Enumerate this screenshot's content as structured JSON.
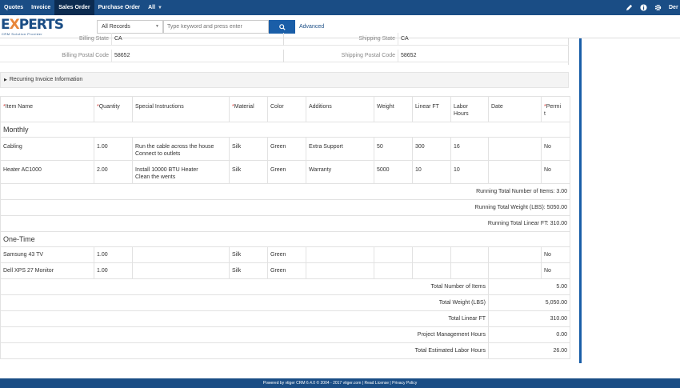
{
  "nav": {
    "tabs": [
      "Quotes",
      "Invoice",
      "Sales Order",
      "Purchase Order",
      "All"
    ],
    "active_tab": "Sales Order",
    "user": "Der"
  },
  "header": {
    "logo_main": "E",
    "logo_x": "X",
    "logo_rest": "PERTS",
    "logo_sub": "CRM Solution Provider",
    "records_select": "All Records",
    "search_placeholder": "Type keyword and press enter",
    "advanced_label": "Advanced"
  },
  "address": {
    "billing_state_label": "Billing State",
    "billing_state_value": "CA",
    "shipping_state_label": "Shipping State",
    "shipping_state_value": "CA",
    "billing_postal_label": "Billing Postal Code",
    "billing_postal_value": "58652",
    "shipping_postal_label": "Shipping Postal Code",
    "shipping_postal_value": "58652"
  },
  "recurring_label": "Recurring Invoice Information",
  "table": {
    "columns": [
      "Item Name",
      "Quantity",
      "Special Instructions",
      "Material",
      "Color",
      "Additions",
      "Weight",
      "Linear FT",
      "Labor Hours",
      "Date",
      "Permit"
    ],
    "col_labels": {
      "item": "Item Name",
      "qty": "Quantity",
      "special": "Special Instructions",
      "material": "Material",
      "color": "Color",
      "additions": "Additions",
      "weight": "Weight",
      "linear": "Linear FT",
      "labor_a": "Labor",
      "labor_b": "Hours",
      "date": "Date",
      "permit_a": "Permi",
      "permit_b": "t"
    },
    "group_monthly": "Monthly",
    "monthly_rows": [
      {
        "item": "Cabling",
        "qty": "1.00",
        "special1": "Run the cable across the house",
        "special2": "Connect to outlets",
        "material": "Silk",
        "color": "Green",
        "additions": "Extra Support",
        "weight": "50",
        "linear": "300",
        "labor": "16",
        "date": "",
        "permit": "No"
      },
      {
        "item": "Heater AC1000",
        "qty": "2.00",
        "special1": "Install 10000 BTU Heater",
        "special2": "Clean the wents",
        "material": "Silk",
        "color": "Green",
        "additions": "Warranty",
        "weight": "5000",
        "linear": "10",
        "labor": "10",
        "date": "",
        "permit": "No"
      }
    ],
    "running_items": "Running Total Number of Items: 3.00",
    "running_weight": "Running Total Weight (LBS): 5050.00",
    "running_linear": "Running Total Linear FT: 310.00",
    "group_onetime": "One-Time",
    "onetime_rows": [
      {
        "item": "Samsung 43 TV",
        "qty": "1.00",
        "material": "Silk",
        "color": "Green",
        "permit": "No"
      },
      {
        "item": "Dell XPS 27 Monitor",
        "qty": "1.00",
        "material": "Silk",
        "color": "Green",
        "permit": "No"
      }
    ],
    "summary": [
      {
        "label": "Total Number of Items",
        "value": "5.00"
      },
      {
        "label": "Total Weight (LBS)",
        "value": "5,050.00"
      },
      {
        "label": "Total Linear FT",
        "value": "310.00"
      },
      {
        "label": "Project Management Hours",
        "value": "0.00"
      },
      {
        "label": "Total Estimated Labor Hours",
        "value": "26.00"
      }
    ]
  },
  "footer": "Powered by vtiger CRM 6.4.0  © 2004 - 2017  vtiger.com | Read License | Privacy Policy",
  "icons": {
    "edit": "pencil-icon",
    "info": "info-icon",
    "settings": "gear-icon",
    "search": "search-icon",
    "caret": "chevron-down-icon"
  },
  "colors": {
    "nav_bg": "#1a4d85",
    "nav_active": "#0c2b50",
    "required": "#d9312b",
    "accent": "#e8863a"
  }
}
